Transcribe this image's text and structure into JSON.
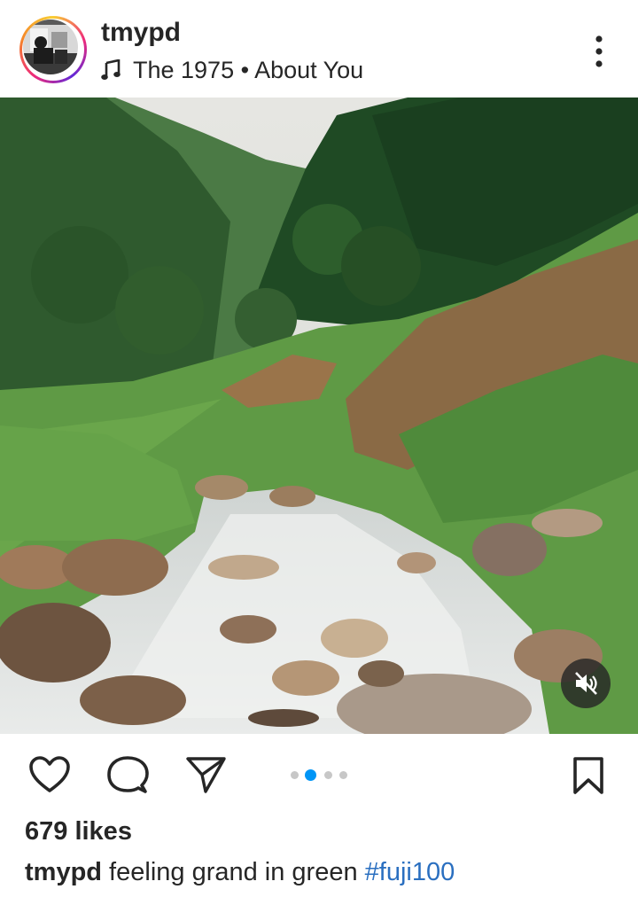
{
  "post": {
    "username": "tmypd",
    "audio": {
      "artist": "The 1975",
      "separator": " • ",
      "track": "About You"
    },
    "likes_text": "679 likes",
    "caption": {
      "username": "tmypd",
      "text": " feeling grand in green ",
      "hashtag": "#fuji100"
    },
    "carousel": {
      "count": 4,
      "active_index": 1
    },
    "audio_muted": true
  },
  "icons": {
    "more": "more-vertical-icon",
    "music": "music-note-icon",
    "like": "heart-icon",
    "comment": "comment-bubble-icon",
    "share": "paper-plane-icon",
    "save": "bookmark-icon",
    "mute": "speaker-muted-icon"
  },
  "colors": {
    "text": "#262626",
    "hashtag": "#2a6fc0",
    "carousel_active": "#0095f6",
    "carousel_inactive": "#c7c7c7"
  }
}
